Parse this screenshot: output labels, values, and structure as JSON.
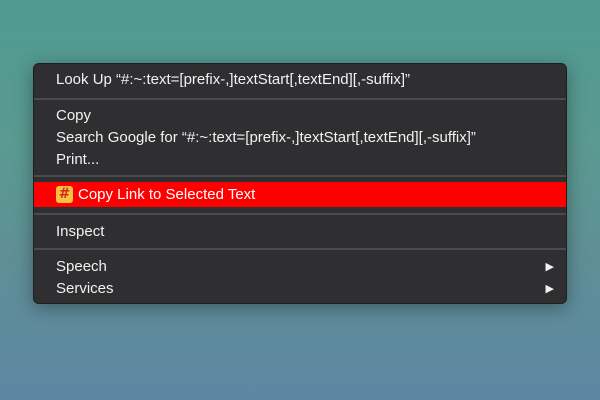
{
  "context_menu": {
    "look_up": "Look Up “#:~:text=[prefix-,]textStart[,textEnd][,-suffix]”",
    "copy": "Copy",
    "search_google": "Search Google for “#:~:text=[prefix-,]textStart[,textEnd][,-suffix]”",
    "print": "Print...",
    "copy_link": "Copy Link to Selected Text",
    "copy_link_icon": "hash-icon",
    "copy_link_icon_glyph": "#",
    "inspect": "Inspect",
    "speech": "Speech",
    "services": "Services",
    "submenu_arrow": "▶",
    "highlight_color": "#ff0000"
  }
}
